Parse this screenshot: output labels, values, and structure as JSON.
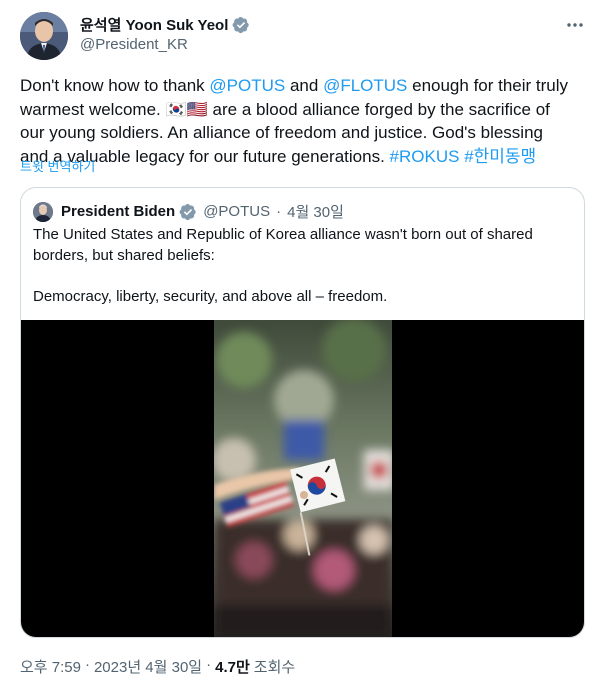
{
  "author": {
    "display_name": "윤석열 Yoon Suk Yeol",
    "handle": "@President_KR",
    "verified_icon": "verified-badge-icon",
    "avatar_icon": "profile-avatar"
  },
  "tweet": {
    "lines": [
      [
        {
          "text": "Don't know how to thank ",
          "link": false
        },
        {
          "text": "@POTUS",
          "link": true
        },
        {
          "text": " and ",
          "link": false
        },
        {
          "text": "@FLOTUS",
          "link": true
        },
        {
          "text": " enough for their truly",
          "link": false
        }
      ],
      [
        {
          "text": "warmest welcome. 🇰🇷🇺🇸 are a blood alliance forged by the sacrifice of",
          "link": false
        }
      ],
      [
        {
          "text": "our young soldiers. An alliance of freedom and justice. God's blessing",
          "link": false
        }
      ],
      [
        {
          "text": "and a valuable legacy for our future generations. ",
          "link": false
        },
        {
          "text": "#ROKUS",
          "link": true
        },
        {
          "text": " ",
          "link": false
        },
        {
          "text": "#한미동맹",
          "link": true
        }
      ]
    ],
    "translate_label": "트윗 번역하기"
  },
  "quote": {
    "name": "President Biden",
    "handle": "@POTUS",
    "separator": "·",
    "date": "4월 30일",
    "lines": [
      "The United States and Republic of Korea alliance wasn't born out of shared",
      "borders, but shared beliefs:",
      "",
      "Democracy, liberty, security, and above all – freedom."
    ]
  },
  "footer": {
    "time": "오후 7:59",
    "dot1": "·",
    "date": "2023년 4월 30일",
    "dot2": "·",
    "views_count": "4.7만",
    "views_label": "조회수"
  },
  "colors": {
    "link": "#1d9bf0",
    "text": "#0f1419",
    "muted": "#536471",
    "border": "#cfd9de",
    "verified": "#829aab"
  }
}
